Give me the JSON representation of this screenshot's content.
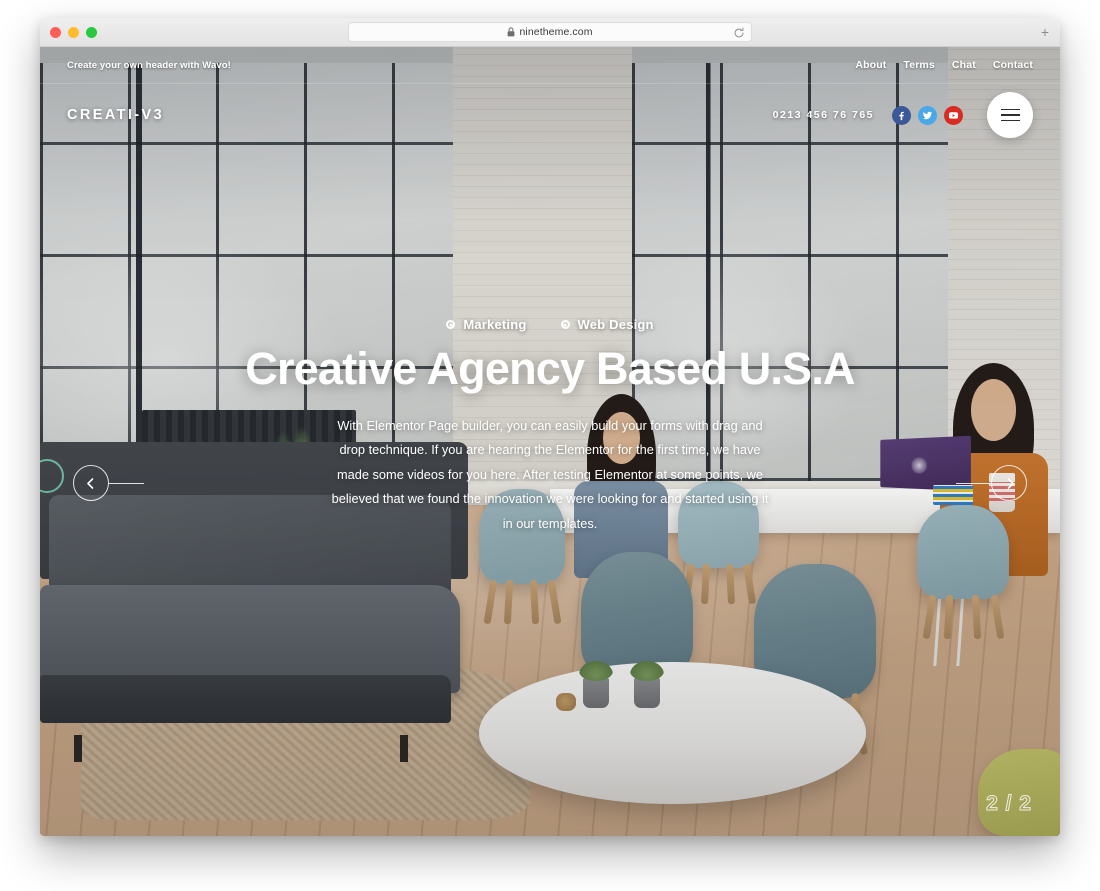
{
  "browser": {
    "url": "ninetheme.com",
    "lock_icon": "lock-icon",
    "reload_icon": "reload-icon",
    "newtab_label": "+",
    "traffic_lights": [
      "close",
      "minimize",
      "maximize"
    ]
  },
  "site": {
    "topbar": {
      "tagline": "Create your own header with Wavo!",
      "nav": [
        {
          "label": "About"
        },
        {
          "label": "Terms"
        },
        {
          "label": "Chat"
        },
        {
          "label": "Contact"
        }
      ]
    },
    "header": {
      "logo": "CREATI-V3",
      "phone": "0213 456 76 765",
      "socials": [
        {
          "name": "facebook-icon",
          "glyph": "f",
          "color": "#3b5998"
        },
        {
          "name": "twitter-icon",
          "glyph": "t",
          "color": "#4aa8e8"
        },
        {
          "name": "youtube-icon",
          "glyph": "y",
          "color": "#d92b22"
        }
      ],
      "menu_button": "menu"
    },
    "hero": {
      "categories": [
        {
          "label": "Marketing"
        },
        {
          "label": "Web Design"
        }
      ],
      "title": "Creative Agency Based U.S.A",
      "description": "With Elementor Page builder, you can easily build your forms with drag and drop technique. If you are hearing the Elementor for the first time, we have made some videos for you here. After testing Elementor at some points, we believed that we found the innovation we were looking for and started using it in our templates.",
      "prev_label": "Previous slide",
      "next_label": "Next slide",
      "slide_counter": "2 / 2",
      "accent_color": "#78c8af"
    }
  }
}
